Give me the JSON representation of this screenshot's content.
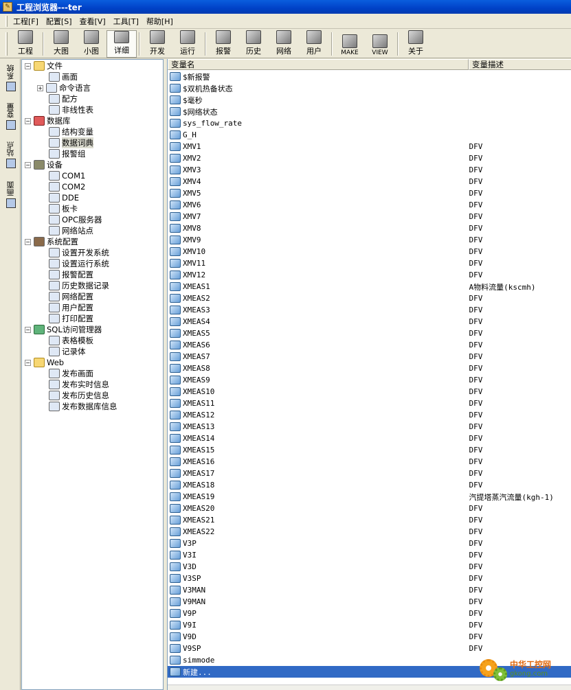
{
  "window": {
    "title": "工程浏览器---ter"
  },
  "menu": [
    "工程[F]",
    "配置[S]",
    "查看[V]",
    "工具[T]",
    "帮助[H]"
  ],
  "toolbar": [
    {
      "label": "工程",
      "icon": "project-icon"
    },
    {
      "sep": true
    },
    {
      "label": "大图",
      "icon": "large-icons-icon"
    },
    {
      "label": "小图",
      "icon": "small-icons-icon"
    },
    {
      "label": "详细",
      "icon": "details-icon",
      "active": true
    },
    {
      "sep": true
    },
    {
      "label": "开发",
      "icon": "develop-icon"
    },
    {
      "label": "运行",
      "icon": "run-icon"
    },
    {
      "sep": true
    },
    {
      "label": "报警",
      "icon": "alarm-icon"
    },
    {
      "label": "历史",
      "icon": "history-icon"
    },
    {
      "label": "网络",
      "icon": "network-icon"
    },
    {
      "label": "用户",
      "icon": "user-icon"
    },
    {
      "sep": true
    },
    {
      "label": "MAKE",
      "icon": "make-icon"
    },
    {
      "label": "VIEW",
      "icon": "view-icon"
    },
    {
      "sep": true
    },
    {
      "label": "关于",
      "icon": "about-icon"
    }
  ],
  "vtabs": [
    {
      "label": "系统",
      "icon": "system-tab-icon"
    },
    {
      "label": "变量",
      "icon": "variable-tab-icon"
    },
    {
      "label": "站点",
      "icon": "station-tab-icon"
    },
    {
      "label": "画面",
      "icon": "screen-tab-icon"
    }
  ],
  "tree": [
    {
      "label": "文件",
      "level": 0,
      "expander": "−",
      "icon": "folder"
    },
    {
      "label": "画面",
      "level": 1,
      "icon": "leaf"
    },
    {
      "label": "命令语言",
      "level": 1,
      "expander": "+",
      "icon": "leaf"
    },
    {
      "label": "配方",
      "level": 1,
      "icon": "leaf"
    },
    {
      "label": "非线性表",
      "level": 1,
      "icon": "leaf"
    },
    {
      "label": "数据库",
      "level": 0,
      "expander": "−",
      "icon": "db"
    },
    {
      "label": "结构变量",
      "level": 1,
      "icon": "leaf"
    },
    {
      "label": "数据词典",
      "level": 1,
      "icon": "leaf",
      "selected": true
    },
    {
      "label": "报警组",
      "level": 1,
      "icon": "leaf"
    },
    {
      "label": "设备",
      "level": 0,
      "expander": "−",
      "icon": "dev"
    },
    {
      "label": "COM1",
      "level": 1,
      "icon": "leaf"
    },
    {
      "label": "COM2",
      "level": 1,
      "icon": "leaf"
    },
    {
      "label": "DDE",
      "level": 1,
      "icon": "leaf"
    },
    {
      "label": "板卡",
      "level": 1,
      "icon": "leaf"
    },
    {
      "label": "OPC服务器",
      "level": 1,
      "icon": "leaf"
    },
    {
      "label": "网络站点",
      "level": 1,
      "icon": "leaf"
    },
    {
      "label": "系统配置",
      "level": 0,
      "expander": "−",
      "icon": "cfg"
    },
    {
      "label": "设置开发系统",
      "level": 1,
      "icon": "leaf"
    },
    {
      "label": "设置运行系统",
      "level": 1,
      "icon": "leaf"
    },
    {
      "label": "报警配置",
      "level": 1,
      "icon": "leaf"
    },
    {
      "label": "历史数据记录",
      "level": 1,
      "icon": "leaf"
    },
    {
      "label": "网络配置",
      "level": 1,
      "icon": "leaf"
    },
    {
      "label": "用户配置",
      "level": 1,
      "icon": "leaf"
    },
    {
      "label": "打印配置",
      "level": 1,
      "icon": "leaf"
    },
    {
      "label": "SQL访问管理器",
      "level": 0,
      "expander": "−",
      "icon": "sql"
    },
    {
      "label": "表格模板",
      "level": 1,
      "icon": "leaf"
    },
    {
      "label": "记录体",
      "level": 1,
      "icon": "leaf"
    },
    {
      "label": "Web",
      "level": 0,
      "expander": "−",
      "icon": "folder"
    },
    {
      "label": "发布画面",
      "level": 1,
      "icon": "leaf"
    },
    {
      "label": "发布实时信息",
      "level": 1,
      "icon": "leaf"
    },
    {
      "label": "发布历史信息",
      "level": 1,
      "icon": "leaf"
    },
    {
      "label": "发布数据库信息",
      "level": 1,
      "icon": "leaf"
    }
  ],
  "list": {
    "columns": [
      "变量名",
      "变量描述"
    ],
    "rows": [
      [
        "$新报警",
        ""
      ],
      [
        "$双机热备状态",
        ""
      ],
      [
        "$毫秒",
        ""
      ],
      [
        "$网络状态",
        ""
      ],
      [
        "sys_flow_rate",
        ""
      ],
      [
        "G_H",
        ""
      ],
      [
        "XMV1",
        "DFV"
      ],
      [
        "XMV2",
        "DFV"
      ],
      [
        "XMV3",
        "DFV"
      ],
      [
        "XMV4",
        "DFV"
      ],
      [
        "XMV5",
        "DFV"
      ],
      [
        "XMV6",
        "DFV"
      ],
      [
        "XMV7",
        "DFV"
      ],
      [
        "XMV8",
        "DFV"
      ],
      [
        "XMV9",
        "DFV"
      ],
      [
        "XMV10",
        "DFV"
      ],
      [
        "XMV11",
        "DFV"
      ],
      [
        "XMV12",
        "DFV"
      ],
      [
        "XMEAS1",
        "A物料流量(kscmh)"
      ],
      [
        "XMEAS2",
        "DFV"
      ],
      [
        "XMEAS3",
        "DFV"
      ],
      [
        "XMEAS4",
        "DFV"
      ],
      [
        "XMEAS5",
        "DFV"
      ],
      [
        "XMEAS6",
        "DFV"
      ],
      [
        "XMEAS7",
        "DFV"
      ],
      [
        "XMEAS8",
        "DFV"
      ],
      [
        "XMEAS9",
        "DFV"
      ],
      [
        "XMEAS10",
        "DFV"
      ],
      [
        "XMEAS11",
        "DFV"
      ],
      [
        "XMEAS12",
        "DFV"
      ],
      [
        "XMEAS13",
        "DFV"
      ],
      [
        "XMEAS14",
        "DFV"
      ],
      [
        "XMEAS15",
        "DFV"
      ],
      [
        "XMEAS16",
        "DFV"
      ],
      [
        "XMEAS17",
        "DFV"
      ],
      [
        "XMEAS18",
        "DFV"
      ],
      [
        "XMEAS19",
        "汽提塔蒸汽流量(kgh-1)"
      ],
      [
        "XMEAS20",
        "DFV"
      ],
      [
        "XMEAS21",
        "DFV"
      ],
      [
        "XMEAS22",
        "DFV"
      ],
      [
        "V3P",
        "DFV"
      ],
      [
        "V3I",
        "DFV"
      ],
      [
        "V3D",
        "DFV"
      ],
      [
        "V3SP",
        "DFV"
      ],
      [
        "V3MAN",
        "DFV"
      ],
      [
        "V9MAN",
        "DFV"
      ],
      [
        "V9P",
        "DFV"
      ],
      [
        "V9I",
        "DFV"
      ],
      [
        "V9D",
        "DFV"
      ],
      [
        "V9SP",
        "DFV"
      ],
      [
        "simmode",
        ""
      ],
      [
        "新建...",
        ""
      ]
    ],
    "selected_index": 51
  },
  "watermark": {
    "name": "中华工控网",
    "url": "gkong.com"
  }
}
